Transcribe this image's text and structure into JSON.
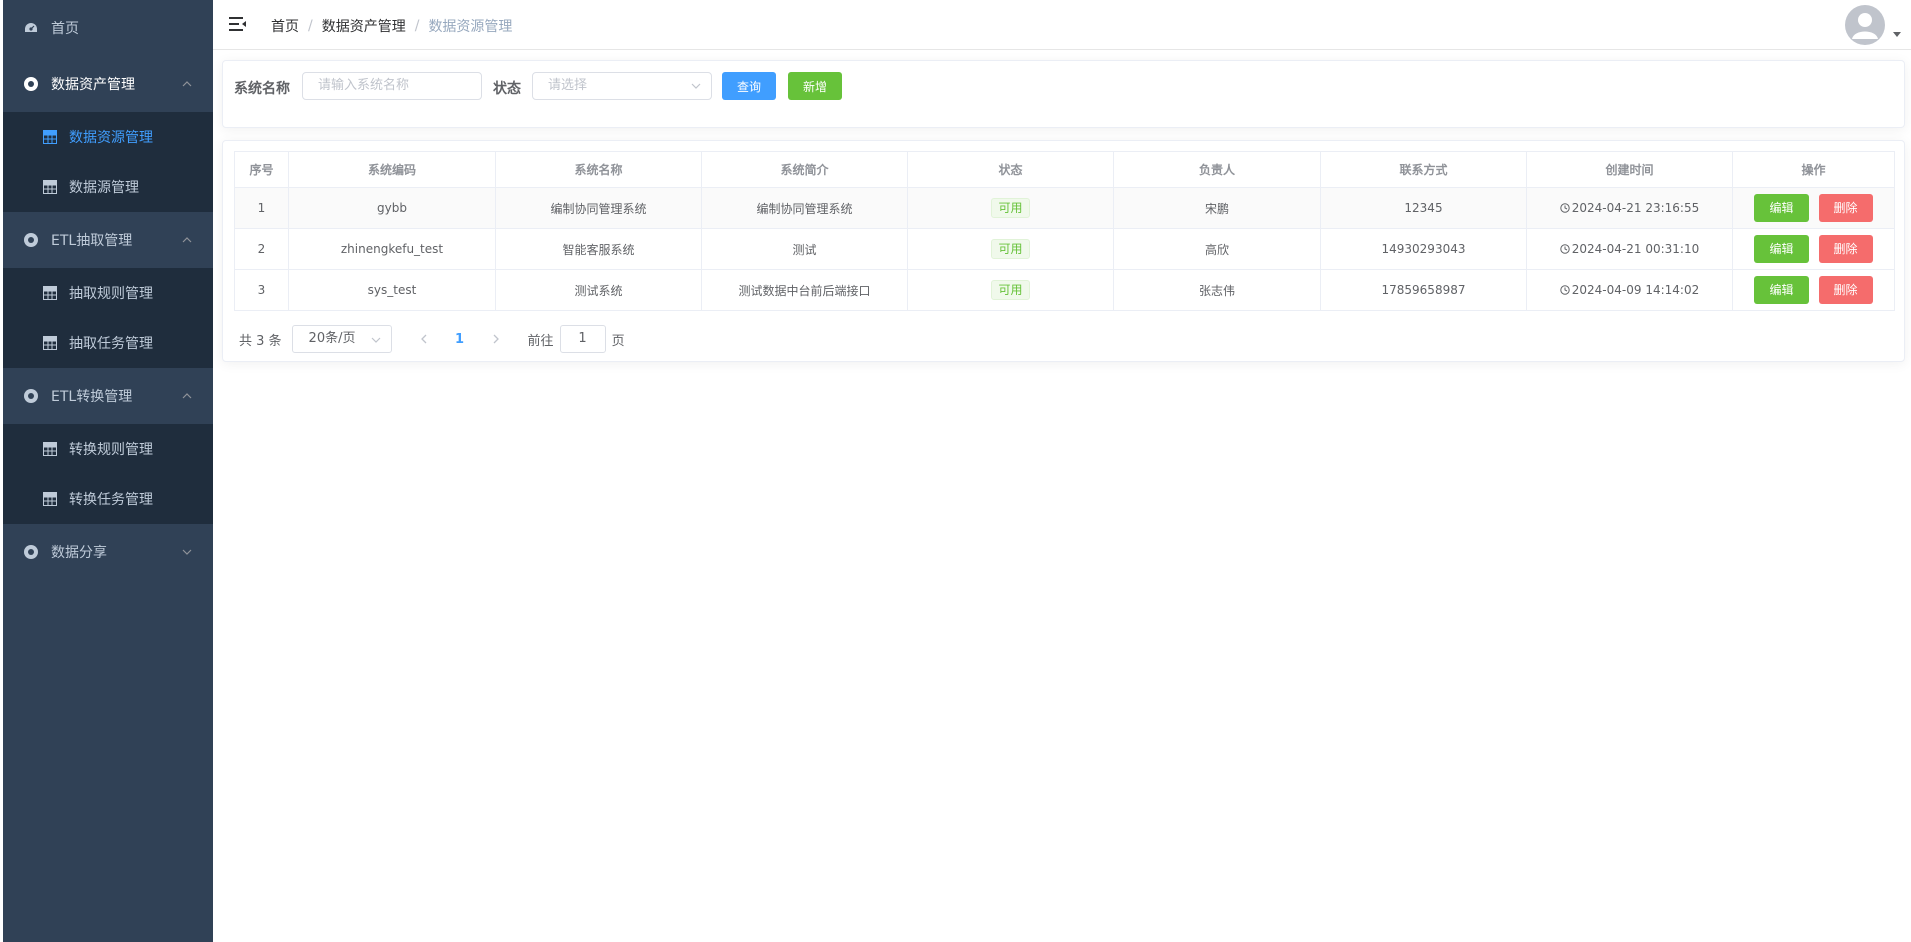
{
  "sidebar": {
    "home": "首页",
    "groups": [
      {
        "label": "数据资产管理",
        "expanded": true,
        "items": [
          "数据资源管理",
          "数据源管理"
        ]
      },
      {
        "label": "ETL抽取管理",
        "expanded": true,
        "items": [
          "抽取规则管理",
          "抽取任务管理"
        ]
      },
      {
        "label": "ETL转换管理",
        "expanded": true,
        "items": [
          "转换规则管理",
          "转换任务管理"
        ]
      },
      {
        "label": "数据分享",
        "expanded": false,
        "items": []
      }
    ],
    "active_item": "数据资源管理",
    "colors": {
      "bg": "#304156",
      "submenu_bg": "#1f2d3d",
      "text": "#bfcbd9",
      "active": "#409eff"
    }
  },
  "header": {
    "breadcrumb": [
      "首页",
      "数据资产管理",
      "数据资源管理"
    ]
  },
  "search": {
    "name_label": "系统名称",
    "name_placeholder": "请输入系统名称",
    "status_label": "状态",
    "status_placeholder": "请选择",
    "query_button": "查询",
    "add_button": "新增"
  },
  "table": {
    "columns": [
      "序号",
      "系统编码",
      "系统名称",
      "系统简介",
      "状态",
      "负责人",
      "联系方式",
      "创建时间",
      "操作"
    ],
    "rows": [
      {
        "index": "1",
        "code": "gybb",
        "name": "编制协同管理系统",
        "intro": "编制协同管理系统",
        "status": "可用",
        "owner": "宋鹏",
        "contact": "12345",
        "created": "2024-04-21 23:16:55"
      },
      {
        "index": "2",
        "code": "zhinengkefu_test",
        "name": "智能客服系统",
        "intro": "测试",
        "status": "可用",
        "owner": "高欣",
        "contact": "14930293043",
        "created": "2024-04-21 00:31:10"
      },
      {
        "index": "3",
        "code": "sys_test",
        "name": "测试系统",
        "intro": "测试数据中台前后端接口",
        "status": "可用",
        "owner": "张志伟",
        "contact": "17859658987",
        "created": "2024-04-09 14:14:02"
      }
    ],
    "edit_label": "编辑",
    "delete_label": "删除"
  },
  "pagination": {
    "total": "共 3 条",
    "page_size": "20条/页",
    "current_page": "1",
    "goto_prefix": "前往",
    "goto_value": "1",
    "goto_suffix": "页"
  }
}
